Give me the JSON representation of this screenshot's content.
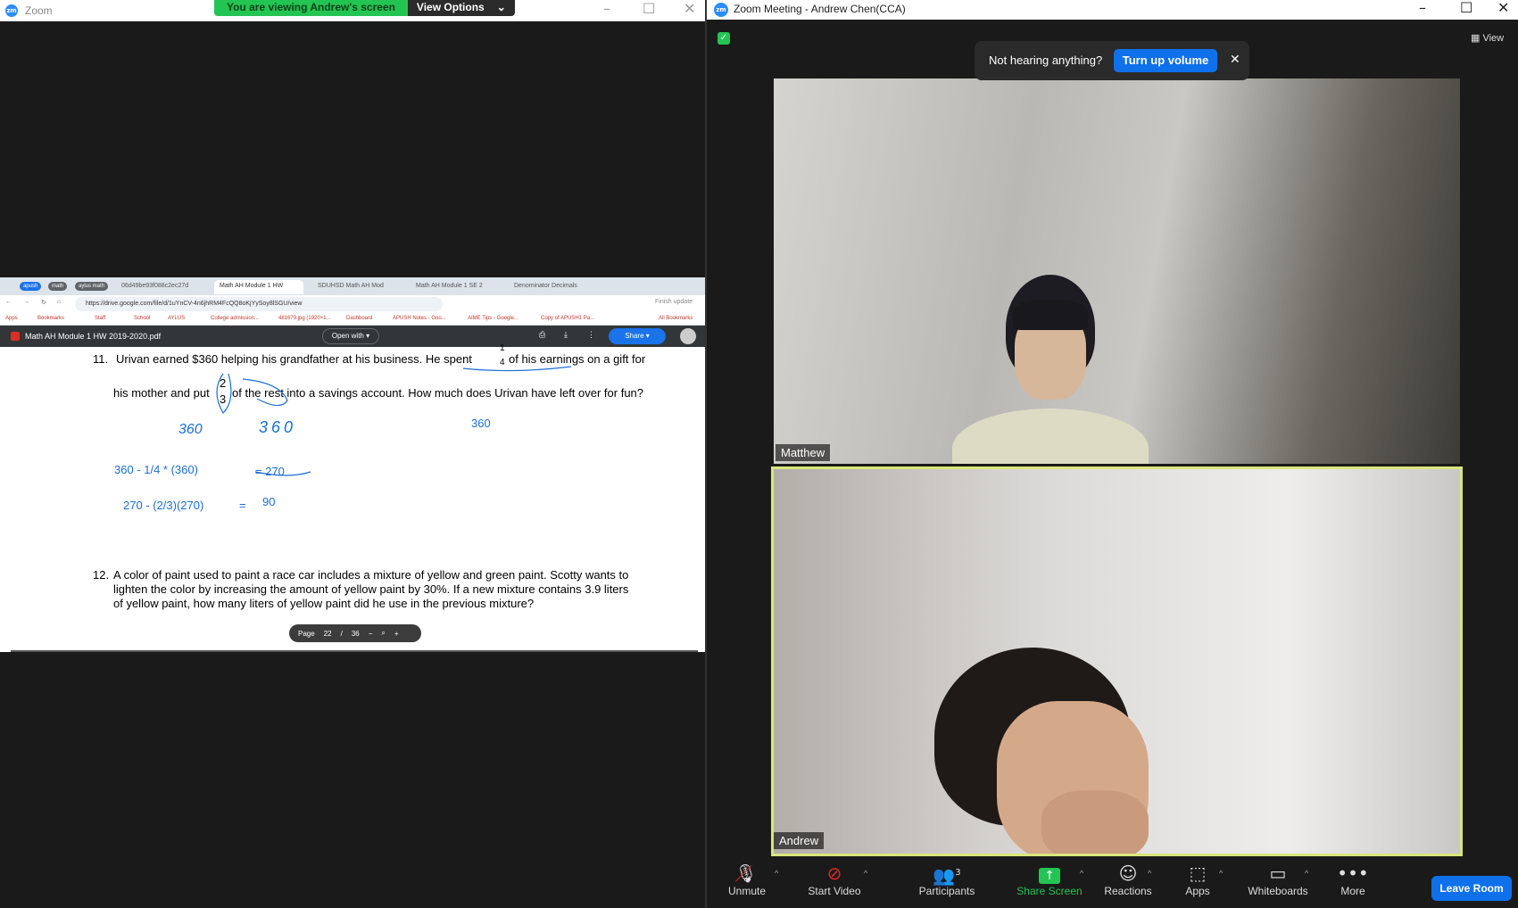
{
  "left_window": {
    "title": "Zoom",
    "banner_text": "You are viewing Andrew's screen",
    "view_options": "View Options"
  },
  "browser": {
    "bookmark_pills": [
      "apush",
      "math",
      "aylus math"
    ],
    "tabs": [
      "06d49be93f088c2ec27d",
      "Math AH Module 1 HW",
      "SDUHSD Math AH Mod",
      "Math AH Module 1 SE 2",
      "Denominator Decimals"
    ],
    "url": "https://drive.google.com/file/d/1uYnCV-4n6jhRM4FcQQ8oKjYySoy8lSGU/view",
    "finish_update": "Finish update",
    "bookmarks": [
      "Apps",
      "Bookmarks",
      "Staff",
      "School",
      "AYLUS",
      "College admission...",
      "481679.jpg (1920×1...",
      "Dashboard",
      "APUSH Notes - Goo...",
      "AIME Tips - Google...",
      "Copy of APUSH1 Pa..."
    ],
    "all_bookmarks": "All Bookmarks"
  },
  "pdf": {
    "file_name": "Math AH Module 1 HW 2019-2020.pdf",
    "open_with": "Open with",
    "share": "Share",
    "q11_num": "11.",
    "q11_line1a": "Urivan earned $360 helping his grandfather at his business. He spent",
    "q11_line1b": "of his earnings on a gift for",
    "q11_frac1_num": "1",
    "q11_frac1_den": "4",
    "q11_line2a": "his mother and put",
    "q11_line2b": "of the rest into a savings account. How much does Urivan have left over for fun?",
    "q11_frac2_num": "2",
    "q11_frac2_den": "3",
    "hw1": "360",
    "hw2": "360",
    "hw3": "360",
    "hw4": "360 - 1/4 * (360)",
    "hw5": "= 270",
    "hw6": "270 - (2/3)(270)",
    "hw7": "=",
    "hw8": "90",
    "q12_num": "12.",
    "q12_line1": "A color of paint used to paint a race car includes a mixture of yellow and green paint.  Scotty wants to",
    "q12_line2": "lighten the color by increasing the amount of yellow paint by 30%.  If a new mixture contains 3.9 liters",
    "q12_line3": "of yellow paint, how many liters of yellow paint did he use in the previous mixture?",
    "page_label": "Page",
    "page_current": "22",
    "page_sep": "/",
    "page_total": "36"
  },
  "meeting": {
    "title": "Zoom Meeting - Andrew Chen(CCA)",
    "view": "View",
    "notice_text": "Not hearing anything?",
    "turn_up": "Turn up volume",
    "participant1": "Matthew",
    "participant2": "Andrew",
    "participants_count": "3"
  },
  "toolbar": {
    "unmute": "Unmute",
    "start_video": "Start Video",
    "participants": "Participants",
    "share_screen": "Share Screen",
    "reactions": "Reactions",
    "apps": "Apps",
    "whiteboards": "Whiteboards",
    "more": "More",
    "leave": "Leave Room"
  },
  "colors": {
    "zoom_blue": "#0e71eb",
    "banner_green": "#23c552",
    "active_speaker": "#d8e67a",
    "share_green": "#23c552"
  }
}
